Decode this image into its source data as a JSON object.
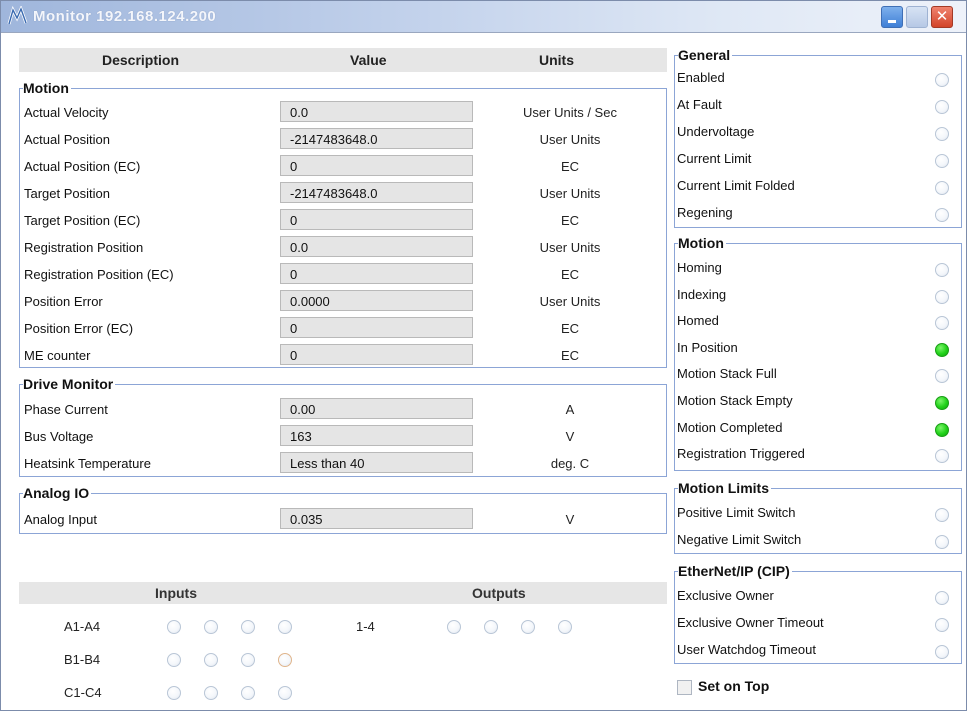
{
  "window": {
    "title": "Monitor  192.168.124.200"
  },
  "table": {
    "header": {
      "description": "Description",
      "value": "Value",
      "units": "Units"
    },
    "groups": [
      {
        "title": "Motion",
        "rows": [
          {
            "label": "Actual Velocity",
            "value": "0.0",
            "unit": "User Units / Sec"
          },
          {
            "label": "Actual Position",
            "value": "-2147483648.0",
            "unit": "User Units"
          },
          {
            "label": "Actual Position (EC)",
            "value": "0",
            "unit": "EC"
          },
          {
            "label": "Target Position",
            "value": "-2147483648.0",
            "unit": "User Units"
          },
          {
            "label": "Target Position (EC)",
            "value": "0",
            "unit": "EC"
          },
          {
            "label": "Registration Position",
            "value": "0.0",
            "unit": "User Units"
          },
          {
            "label": "Registration Position (EC)",
            "value": "0",
            "unit": "EC"
          },
          {
            "label": "Position Error",
            "value": "0.0000",
            "unit": "User Units"
          },
          {
            "label": "Position Error (EC)",
            "value": "0",
            "unit": "EC"
          },
          {
            "label": "ME counter",
            "value": "0",
            "unit": "EC"
          }
        ]
      },
      {
        "title": "Drive Monitor",
        "rows": [
          {
            "label": "Phase Current",
            "value": "0.00",
            "unit": "A"
          },
          {
            "label": "Bus Voltage",
            "value": "163",
            "unit": "V"
          },
          {
            "label": "Heatsink Temperature",
            "value": "Less than 40",
            "unit": "deg. C"
          }
        ]
      },
      {
        "title": "Analog IO",
        "rows": [
          {
            "label": "Analog Input",
            "value": "0.035",
            "unit": "V"
          }
        ]
      }
    ]
  },
  "io": {
    "inputs_label": "Inputs",
    "outputs_label": "Outputs",
    "input_rows": [
      {
        "label": "A1-A4",
        "states": [
          false,
          false,
          false,
          false
        ]
      },
      {
        "label": "B1-B4",
        "states": [
          false,
          false,
          false,
          false
        ]
      },
      {
        "label": "C1-C4",
        "states": [
          false,
          false,
          false,
          false
        ]
      }
    ],
    "output_rows": [
      {
        "label": "1-4",
        "states": [
          false,
          false,
          false,
          false
        ]
      }
    ]
  },
  "status": {
    "general": {
      "title": "General",
      "items": [
        {
          "label": "Enabled",
          "on": false
        },
        {
          "label": "At Fault",
          "on": false
        },
        {
          "label": "Undervoltage",
          "on": false
        },
        {
          "label": "Current Limit",
          "on": false
        },
        {
          "label": "Current Limit Folded",
          "on": false
        },
        {
          "label": "Regening",
          "on": false
        }
      ]
    },
    "motion": {
      "title": "Motion",
      "items": [
        {
          "label": "Homing",
          "on": false
        },
        {
          "label": "Indexing",
          "on": false
        },
        {
          "label": "Homed",
          "on": false
        },
        {
          "label": "In Position",
          "on": true
        },
        {
          "label": "Motion Stack Full",
          "on": false
        },
        {
          "label": "Motion Stack Empty",
          "on": true
        },
        {
          "label": "Motion Completed",
          "on": true
        },
        {
          "label": "Registration Triggered",
          "on": false
        }
      ]
    },
    "motion_limits": {
      "title": "Motion Limits",
      "items": [
        {
          "label": "Positive Limit Switch",
          "on": false
        },
        {
          "label": "Negative Limit Switch",
          "on": false
        }
      ]
    },
    "ethernet_ip": {
      "title": "EtherNet/IP (CIP)",
      "items": [
        {
          "label": "Exclusive Owner",
          "on": false
        },
        {
          "label": "Exclusive Owner Timeout",
          "on": false
        },
        {
          "label": "User Watchdog Timeout",
          "on": false
        }
      ]
    }
  },
  "set_on_top": {
    "label": "Set on Top",
    "checked": false
  },
  "colors": {
    "led_on": "#22d21a",
    "group_border": "#8ca5d6",
    "header_bg": "#e6e6e6"
  }
}
